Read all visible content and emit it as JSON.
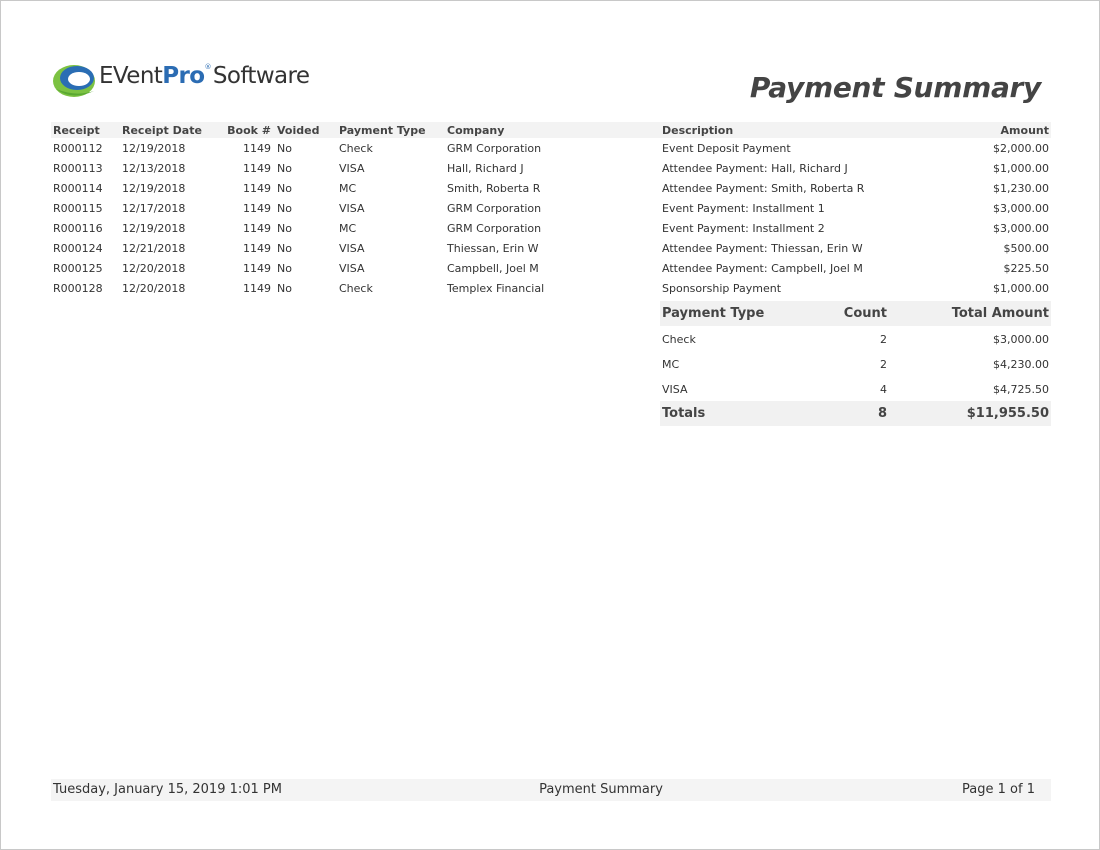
{
  "logo": {
    "brand_pre": "EVent",
    "brand_pro": "Pro",
    "brand_reg": "®",
    "brand_post": "Software"
  },
  "report_title": "Payment Summary",
  "table": {
    "headers": [
      "Receipt",
      "Receipt Date",
      "Book #",
      "Voided",
      "Payment Type",
      "Company",
      "Description",
      "Amount"
    ],
    "rows": [
      [
        "R000112",
        "12/19/2018",
        "1149",
        "No",
        "Check",
        "GRM Corporation",
        "Event Deposit Payment",
        "$2,000.00"
      ],
      [
        "R000113",
        "12/13/2018",
        "1149",
        "No",
        "VISA",
        "Hall, Richard J",
        "Attendee Payment: Hall, Richard J",
        "$1,000.00"
      ],
      [
        "R000114",
        "12/19/2018",
        "1149",
        "No",
        "MC",
        "Smith, Roberta R",
        "Attendee Payment: Smith, Roberta R",
        "$1,230.00"
      ],
      [
        "R000115",
        "12/17/2018",
        "1149",
        "No",
        "VISA",
        "GRM Corporation",
        "Event Payment: Installment 1",
        "$3,000.00"
      ],
      [
        "R000116",
        "12/19/2018",
        "1149",
        "No",
        "MC",
        "GRM Corporation",
        "Event Payment: Installment 2",
        "$3,000.00"
      ],
      [
        "R000124",
        "12/21/2018",
        "1149",
        "No",
        "VISA",
        "Thiessan, Erin W",
        "Attendee Payment: Thiessan, Erin W",
        "$500.00"
      ],
      [
        "R000125",
        "12/20/2018",
        "1149",
        "No",
        "VISA",
        "Campbell, Joel M",
        "Attendee Payment: Campbell, Joel M",
        "$225.50"
      ],
      [
        "R000128",
        "12/20/2018",
        "1149",
        "No",
        "Check",
        "Templex Financial",
        "Sponsorship Payment",
        "$1,000.00"
      ]
    ]
  },
  "summary": {
    "headers": [
      "Payment Type",
      "Count",
      "Total Amount"
    ],
    "rows": [
      [
        "Check",
        "2",
        "$3,000.00"
      ],
      [
        "MC",
        "2",
        "$4,230.00"
      ],
      [
        "VISA",
        "4",
        "$4,725.50"
      ]
    ],
    "totals": {
      "label": "Totals",
      "count": "8",
      "amount": "$11,955.50"
    }
  },
  "footer": {
    "datetime": "Tuesday, January 15, 2019 1:01 PM",
    "title": "Payment Summary",
    "page": "Page 1 of 1"
  }
}
